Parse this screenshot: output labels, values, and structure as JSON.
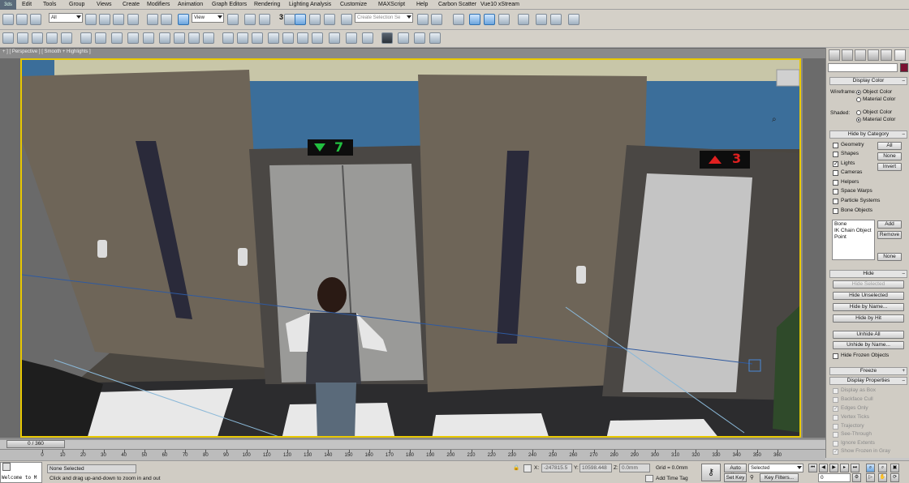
{
  "menu": {
    "logo": "3ds",
    "items": [
      "Edit",
      "Tools",
      "Group",
      "Views",
      "Create",
      "Modifiers",
      "Animation",
      "Graph Editors",
      "Rendering",
      "Lighting Analysis",
      "Customize",
      "MAXScript",
      "Help",
      "Carbon Scatter",
      "Vue10 xStream"
    ]
  },
  "toolbar": {
    "filter_value": "All",
    "ref_coord_value": "View",
    "selection_set_placeholder": "Create Selection Se",
    "snap_label": "3"
  },
  "viewport": {
    "label": "+ ] [ Perspective ] [ Smooth + Highlights ]",
    "elevator_left_floor": "7",
    "elevator_right_floor": "3"
  },
  "panel": {
    "display_color": {
      "title": "Display Color",
      "wireframe_label": "Wireframe:",
      "shaded_label": "Shaded:",
      "object_color": "Object Color",
      "material_color": "Material Color"
    },
    "hide_by_category": {
      "title": "Hide by Category",
      "items": [
        {
          "label": "Geometry",
          "checked": false
        },
        {
          "label": "Shapes",
          "checked": false
        },
        {
          "label": "Lights",
          "checked": true
        },
        {
          "label": "Cameras",
          "checked": false
        },
        {
          "label": "Helpers",
          "checked": false
        },
        {
          "label": "Space Warps",
          "checked": false
        },
        {
          "label": "Particle Systems",
          "checked": false
        },
        {
          "label": "Bone Objects",
          "checked": false
        }
      ],
      "all_button": "All",
      "none_button": "None",
      "invert_button": "Invert",
      "list_items": [
        "Bone",
        "IK Chain Object",
        "Point"
      ],
      "add_button": "Add",
      "remove_button": "Remove",
      "none_button_2": "None"
    },
    "hide": {
      "title": "Hide",
      "buttons": [
        "Hide Selected",
        "Hide Unselected",
        "Hide by Name...",
        "Hide by Hit",
        "Unhide All",
        "Unhide by Name..."
      ],
      "frozen_label": "Hide Frozen Objects"
    },
    "freeze": {
      "title": "Freeze"
    },
    "display_properties": {
      "title": "Display Properties",
      "items": [
        {
          "label": "Display as Box",
          "checked": false
        },
        {
          "label": "Backface Cull",
          "checked": false
        },
        {
          "label": "Edges Only",
          "checked": true
        },
        {
          "label": "Vertex Ticks",
          "checked": false
        },
        {
          "label": "Trajectory",
          "checked": false
        },
        {
          "label": "See-Through",
          "checked": false
        },
        {
          "label": "Ignore Extents",
          "checked": false
        },
        {
          "label": "Show Frozen in Gray",
          "checked": true
        }
      ]
    }
  },
  "timeline": {
    "slider": "0 / 360",
    "ticks": [
      "0",
      "10",
      "20",
      "30",
      "40",
      "50",
      "60",
      "70",
      "80",
      "90",
      "100",
      "110",
      "120",
      "130",
      "140",
      "150",
      "160",
      "170",
      "180",
      "190",
      "200",
      "210",
      "220",
      "230",
      "240",
      "250",
      "260",
      "270",
      "280",
      "290",
      "300",
      "310",
      "320",
      "330",
      "340",
      "350",
      "360"
    ]
  },
  "status": {
    "maxscript": "Welcome to M",
    "selection": "None Selected",
    "prompt": "Click and drag up-and-down to zoom in and out",
    "x_label": "X:",
    "x_value": "-247815.5",
    "y_label": "Y:",
    "y_value": "10598.448",
    "z_label": "Z:",
    "z_value": "0.0mm",
    "grid": "Grid = 0.0mm",
    "add_time_tag": "Add Time Tag",
    "auto_key": "Auto Key",
    "set_key": "Set Key",
    "selected_value": "Selected",
    "key_filters": "Key Filters...",
    "frame_value": "0"
  }
}
